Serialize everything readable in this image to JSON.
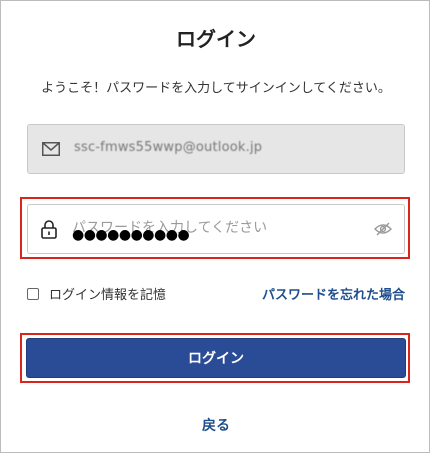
{
  "header": {
    "title": "ログイン"
  },
  "intro": {
    "text": "ようこそ！パスワードを入力してサインインしてください。"
  },
  "email": {
    "value": "ssc-fmws55wwp@outlook.jp",
    "icon": "mail-icon"
  },
  "password": {
    "placeholder": "パスワードを入力してください",
    "value_masked": "●●●●●●●●●●",
    "icon": "lock-icon",
    "toggle_icon": "eye-off-icon"
  },
  "remember": {
    "label": "ログイン情報を記憶",
    "checked": false
  },
  "forgot": {
    "label": "パスワードを忘れた場合"
  },
  "login_button": {
    "label": "ログイン"
  },
  "back": {
    "label": "戻る"
  },
  "colors": {
    "primary": "#2a4b95",
    "link": "#1f4e8c",
    "highlight": "#d9251d",
    "disabled_bg": "#e6e6e6"
  }
}
